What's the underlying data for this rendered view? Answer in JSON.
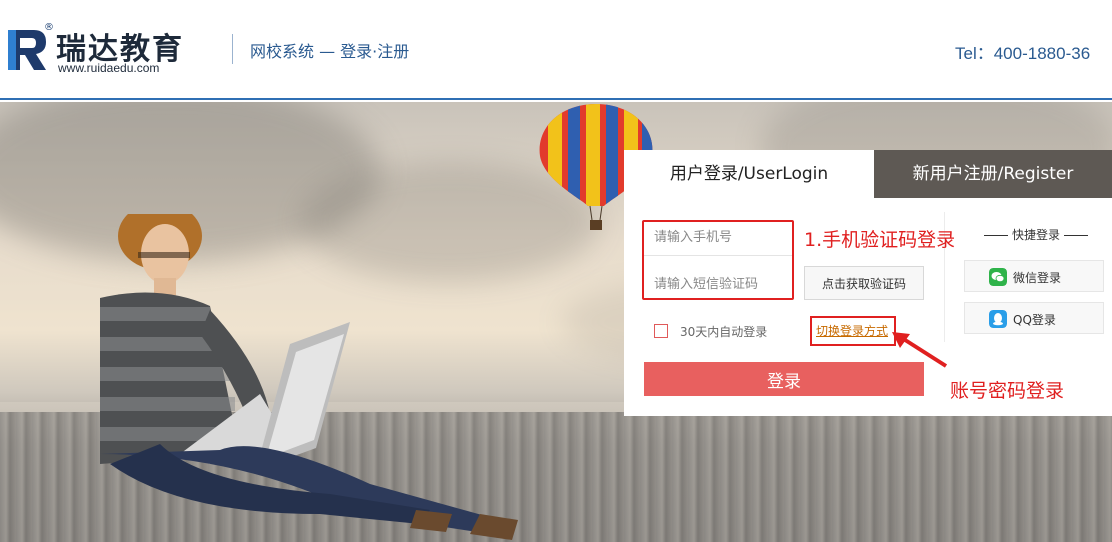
{
  "header": {
    "logo_mark": "R",
    "logo_reg": "®",
    "logo_cn": "瑞达教育",
    "logo_url": "www.ruidaedu.com",
    "title": "网校系统 — 登录·注册",
    "tel": "Tel：400-1880-36"
  },
  "login": {
    "tab_login": "用户登录/UserLogin",
    "tab_register": "新用户注册/Register",
    "phone_placeholder": "请输入手机号",
    "code_placeholder": "请输入短信验证码",
    "get_code_label": "点击获取验证码",
    "remember_label": "30天内自动登录",
    "switch_label": "切换登录方式",
    "submit_label": "登录",
    "quick_title": "快捷登录",
    "wechat_label": "微信登录",
    "qq_label": "QQ登录"
  },
  "annotations": {
    "sms_login": "1.手机验证码登录",
    "password_login": "账号密码登录"
  },
  "colors": {
    "brand_blue": "#2f6fb4",
    "login_button": "#e8605f",
    "register_tab": "#5e5954",
    "annotation_red": "#e02020",
    "wechat_green": "#2fb34a",
    "qq_blue": "#2a9ee8"
  },
  "icons": {
    "logo": "ruida-logo-icon",
    "wechat": "wechat-icon",
    "qq": "qq-icon",
    "arrow": "arrow-icon"
  }
}
